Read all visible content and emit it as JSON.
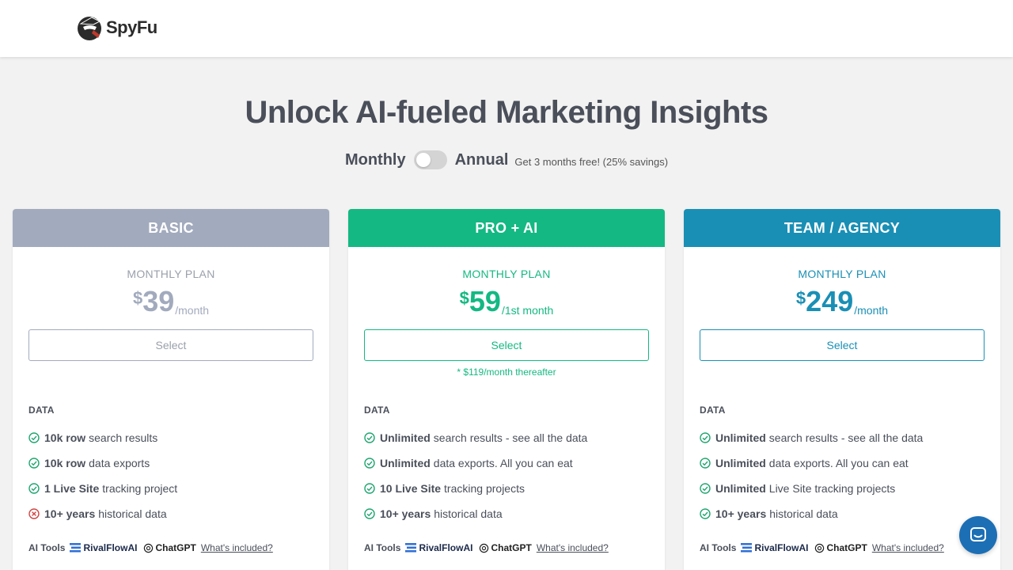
{
  "header": {
    "logo_text": "SpyFu"
  },
  "hero": {
    "title": "Unlock AI-fueled Marketing Insights"
  },
  "billing": {
    "monthly": "Monthly",
    "annual": "Annual",
    "savings": "Get 3 months free! (25% savings)",
    "annual_selected": false
  },
  "colors": {
    "basic": "#a2aabd",
    "pro": "#14b882",
    "team": "#1a8fb5",
    "check": "#1fa56f",
    "cross": "#d04545"
  },
  "plans": [
    {
      "name": "BASIC",
      "plan_label": "MONTHLY PLAN",
      "currency": "$",
      "amount": "39",
      "period": "/month",
      "select": "Select",
      "note": "",
      "section": "DATA",
      "features": [
        {
          "bold": "10k row",
          "text": "search results",
          "icon": "check-circle-icon"
        },
        {
          "bold": "10k row",
          "text": "data exports",
          "icon": "check-circle-icon"
        },
        {
          "bold": "1 Live Site",
          "text": "tracking project",
          "icon": "check-circle-icon"
        },
        {
          "bold": "10+ years",
          "text": "historical data",
          "icon": "x-circle-icon"
        }
      ],
      "ai_label": "AI Tools",
      "rivalflow": "RivalFlowAI",
      "chatgpt": "ChatGPT",
      "whats": "What's included?"
    },
    {
      "name": "PRO + AI",
      "plan_label": "MONTHLY PLAN",
      "currency": "$",
      "amount": "59",
      "period": "/1st month",
      "select": "Select",
      "note": "* $119/month thereafter",
      "section": "DATA",
      "features": [
        {
          "bold": "Unlimited",
          "text": "search results - see all the data",
          "icon": "check-circle-icon"
        },
        {
          "bold": "Unlimited",
          "text": "data exports. All you can eat",
          "icon": "check-circle-icon"
        },
        {
          "bold": "10 Live Site",
          "text": "tracking projects",
          "icon": "check-circle-icon"
        },
        {
          "bold": "10+ years",
          "text": "historical data",
          "icon": "check-circle-icon"
        }
      ],
      "ai_label": "AI Tools",
      "rivalflow": "RivalFlowAI",
      "chatgpt": "ChatGPT",
      "whats": "What's included?"
    },
    {
      "name": "TEAM / AGENCY",
      "plan_label": "MONTHLY PLAN",
      "currency": "$",
      "amount": "249",
      "period": "/month",
      "select": "Select",
      "note": "",
      "section": "DATA",
      "features": [
        {
          "bold": "Unlimited",
          "text": "search results - see all the data",
          "icon": "check-circle-icon"
        },
        {
          "bold": "Unlimited",
          "text": "data exports. All you can eat",
          "icon": "check-circle-icon"
        },
        {
          "bold": "Unlimited",
          "text": "Live Site tracking projects",
          "icon": "check-circle-icon"
        },
        {
          "bold": "10+ years",
          "text": "historical data",
          "icon": "check-circle-icon"
        }
      ],
      "ai_label": "AI Tools",
      "rivalflow": "RivalFlowAI",
      "chatgpt": "ChatGPT",
      "whats": "What's included?"
    }
  ]
}
